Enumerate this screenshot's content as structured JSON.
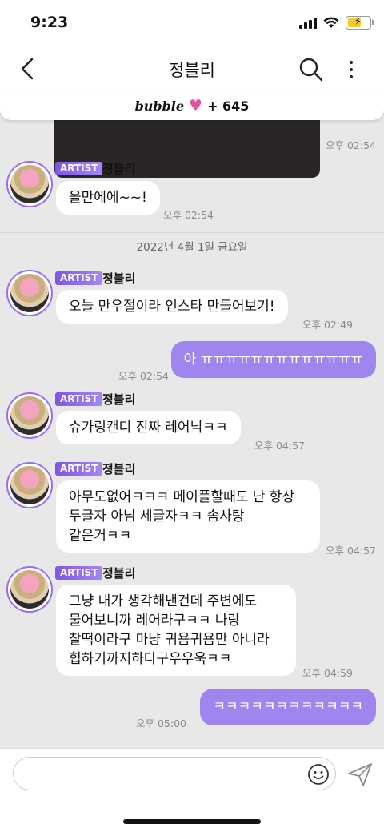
{
  "status_bar": {
    "time": "9:23"
  },
  "nav": {
    "title": "정블리"
  },
  "banner": {
    "brand": "bubble",
    "count": "+ 645"
  },
  "media": {
    "timestamp": "오후 02:54"
  },
  "messages": [
    {
      "badge": "ARTIST",
      "name": "정블리",
      "text": "올만에에~~!",
      "time": "오후 02:54"
    },
    {
      "badge": "ARTIST",
      "name": "정블리",
      "text": "오늘 만우절이라 인스타 만들어보기!",
      "time": "오후 02:49"
    },
    {
      "text": "아 ㅠㅠㅠㅠㅠㅠㅠㅠㅠㅠㅠㅠㅠ",
      "time": "오후 02:54"
    },
    {
      "badge": "ARTIST",
      "name": "정블리",
      "text": "슈가링캔디 진짜 레어닉ㅋㅋ",
      "time": "오후 04:57"
    },
    {
      "badge": "ARTIST",
      "name": "정블리",
      "lines": [
        "아무도없어ㅋㅋㅋ 메이플할때도 난 항상",
        "두글자 아님 세글자ㅋㅋ 솜사탕",
        "같은거ㅋㅋ"
      ],
      "time": "오후 04:57"
    },
    {
      "badge": "ARTIST",
      "name": "정블리",
      "lines": [
        "그냥 내가 생각해낸건데 주변에도",
        "물어보니까 레어라구ㅋㅋ 나랑",
        "찰떡이라구 마냥 귀욤귀욤만 아니라",
        "힙하기까지하다구우우욱ㅋㅋ"
      ],
      "time": "오후 04:59"
    },
    {
      "text": "ㅋㅋㅋㅋㅋㅋㅋㅋㅋㅋㅋㅋ",
      "time": "오후 05:00"
    }
  ],
  "date_separator": "2022년 4월 1일 금요일",
  "input": {
    "placeholder": ""
  }
}
